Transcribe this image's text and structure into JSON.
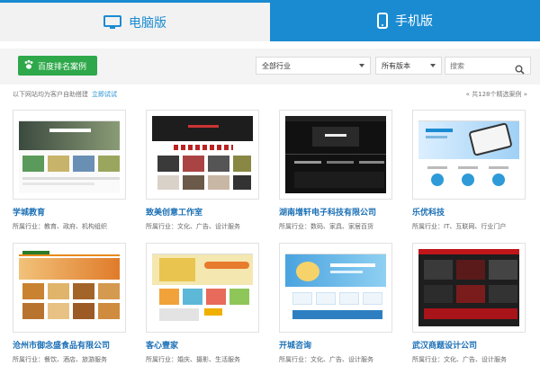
{
  "tabs": {
    "pc_label": "电脑版",
    "mobile_label": "手机版"
  },
  "filter": {
    "baidu_button_label": "百度排名案例",
    "industry_select": "全部行业",
    "version_select": "所有版本",
    "search_placeholder": "搜索"
  },
  "info": {
    "left_text": "以下网站均为客户自助搭建",
    "left_link": "立即试试",
    "right_text": "« 共128个精选案例 »"
  },
  "cards": [
    {
      "title": "学城教育",
      "meta": "所属行业：教育、政府、机构组织"
    },
    {
      "title": "致美创意工作室",
      "meta": "所属行业：文化、广告、设计服务"
    },
    {
      "title": "湖南增轩电子科技有限公司",
      "meta": "所属行业：数码、家具、家居百货"
    },
    {
      "title": "乐优科技",
      "meta": "所属行业：IT、互联网、行业门户"
    },
    {
      "title": "沧州市御念盛食品有限公司",
      "meta": "所属行业：餐饮、酒店、旅游服务"
    },
    {
      "title": "客心壹家",
      "meta": "所属行业：婚庆、摄影、生活服务"
    },
    {
      "title": "开城咨询",
      "meta": "所属行业：文化、广告、设计服务"
    },
    {
      "title": "武汉商题设计公司",
      "meta": "所属行业：文化、广告、设计服务"
    }
  ],
  "colors": {
    "accent": "#1a8bd1",
    "baidu_green": "#2ea84a",
    "title_blue": "#1a6fb5"
  },
  "icons": {
    "pc": "monitor-icon",
    "mobile": "phone-icon",
    "baidu": "paw-icon",
    "search": "search-icon"
  }
}
